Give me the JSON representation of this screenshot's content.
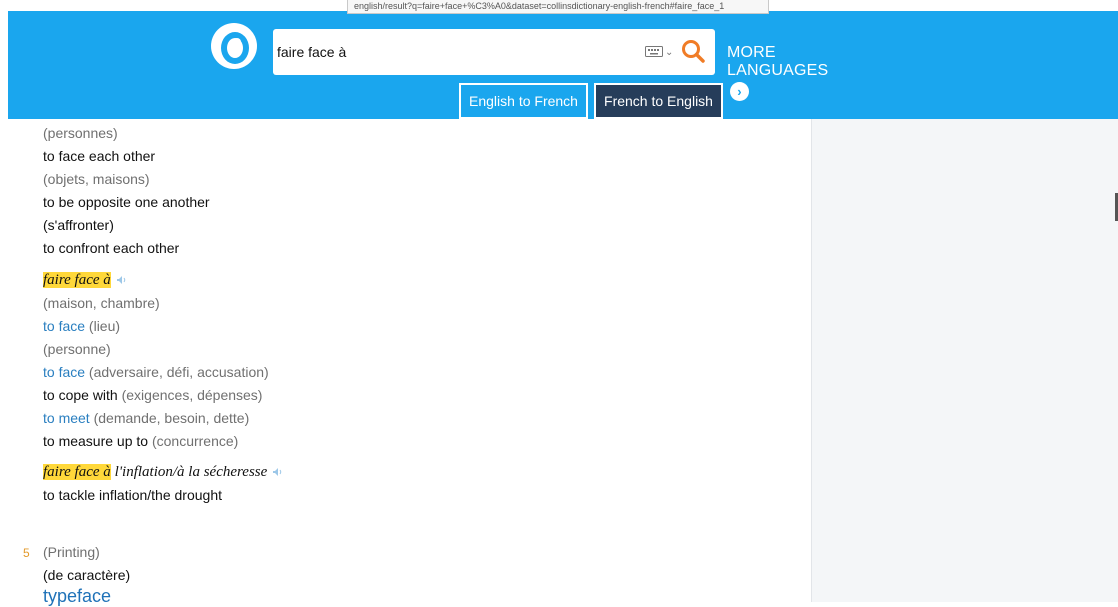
{
  "tooltip": {
    "text": "english/result?q=faire+face+%C3%A0&dataset=collinsdictionary-english-french#faire_face_1"
  },
  "search": {
    "value": "faire face à"
  },
  "header": {
    "more_languages": "MORE LANGUAGES",
    "tab_en_fr": "English to French",
    "tab_fr_en": "French to English",
    "active_tab": "French to English"
  },
  "entries": {
    "l1": "(personnes)",
    "l2": "to face each other",
    "l3": "(objets, maisons)",
    "l4": "to be opposite one another",
    "l5": "(s'affronter)",
    "l6": "to confront each other",
    "phrase1": "faire face à",
    "p1_l1": "(maison, chambre)",
    "p1_l2_link": "to face",
    "p1_l2_note": "(lieu)",
    "p1_l3": "(personne)",
    "p1_l4_link": "to face",
    "p1_l4_note": "(adversaire, défi, accusation)",
    "p1_l5_text": "to cope with",
    "p1_l5_note": "(exigences, dépenses)",
    "p1_l6_link": "to meet",
    "p1_l6_note": "(demande, besoin, dette)",
    "p1_l7_text": "to measure up to",
    "p1_l7_note": "(concurrence)",
    "phrase2_hl": "faire face à",
    "phrase2_rest": "l'inflation/à la sécheresse",
    "p2_l1": "to tackle inflation/the drought",
    "sense_num": "5",
    "sense_label": "(Printing)",
    "sense_sub": "(de caractère)",
    "sense_headword": "typeface"
  },
  "colors": {
    "brand": "#1aa6ee",
    "active_tab": "#263d5a",
    "highlight": "#ffd83a",
    "link": "#2a7fc0",
    "search_icon": "#f07c26"
  }
}
